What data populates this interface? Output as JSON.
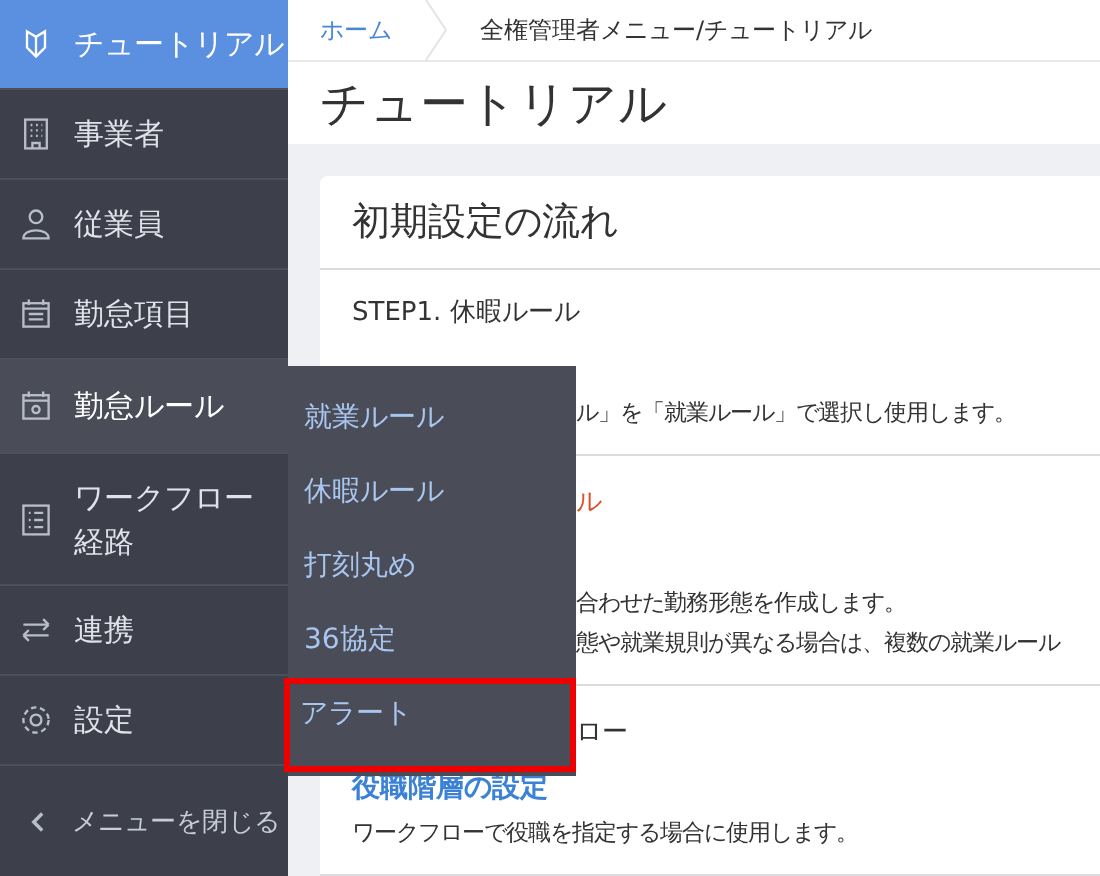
{
  "sidebar": {
    "items": [
      {
        "label": "チュートリアル",
        "selected": true,
        "expanded": false
      },
      {
        "label": "事業者",
        "selected": false,
        "expanded": false
      },
      {
        "label": "従業員",
        "selected": false,
        "expanded": false
      },
      {
        "label": "勤怠項目",
        "selected": false,
        "expanded": false
      },
      {
        "label": "勤怠ルール",
        "selected": false,
        "expanded": true
      },
      {
        "label": "ワークフロー経路",
        "selected": false,
        "expanded": false
      },
      {
        "label": "連携",
        "selected": false,
        "expanded": false
      },
      {
        "label": "設定",
        "selected": false,
        "expanded": false
      }
    ],
    "close": {
      "label": "メニューを閉じる"
    }
  },
  "submenu": {
    "items": [
      {
        "label": "就業ルール",
        "highlighted": false
      },
      {
        "label": "休暇ルール",
        "highlighted": false
      },
      {
        "label": "打刻丸め",
        "highlighted": false
      },
      {
        "label": "36協定",
        "highlighted": false
      },
      {
        "label": "アラート",
        "highlighted": true
      }
    ]
  },
  "breadcrumb": [
    "ホーム",
    "全権管理者メニュー/チュートリアル"
  ],
  "page_title": "チュートリアル",
  "card": {
    "title": "初期設定の流れ",
    "sections": [
      {
        "heading": {
          "text": "STEP1. 休暇ルール",
          "kind": "full",
          "color": "#333333"
        },
        "lines": [
          {
            "kind": "fragment",
            "text": "ル」を「就業ルール」で選択し使用します。"
          }
        ]
      },
      {
        "heading": {
          "text": "ル",
          "kind": "fragment",
          "color": "#d9532c"
        },
        "lines": [
          {
            "kind": "fragment",
            "text": "合わせた勤務形態を作成します。"
          },
          {
            "kind": "fragment",
            "text": "態や就業規則が異なる場合は、複数の就業ルール"
          }
        ]
      },
      {
        "heading": {
          "text": "ロー",
          "kind": "fragment",
          "color": "#333333"
        },
        "lines": [
          {
            "kind": "link",
            "text": "役職階層の設定"
          },
          {
            "kind": "full",
            "text": "ワークフローで役職を指定する場合に使用します。"
          }
        ]
      }
    ]
  }
}
